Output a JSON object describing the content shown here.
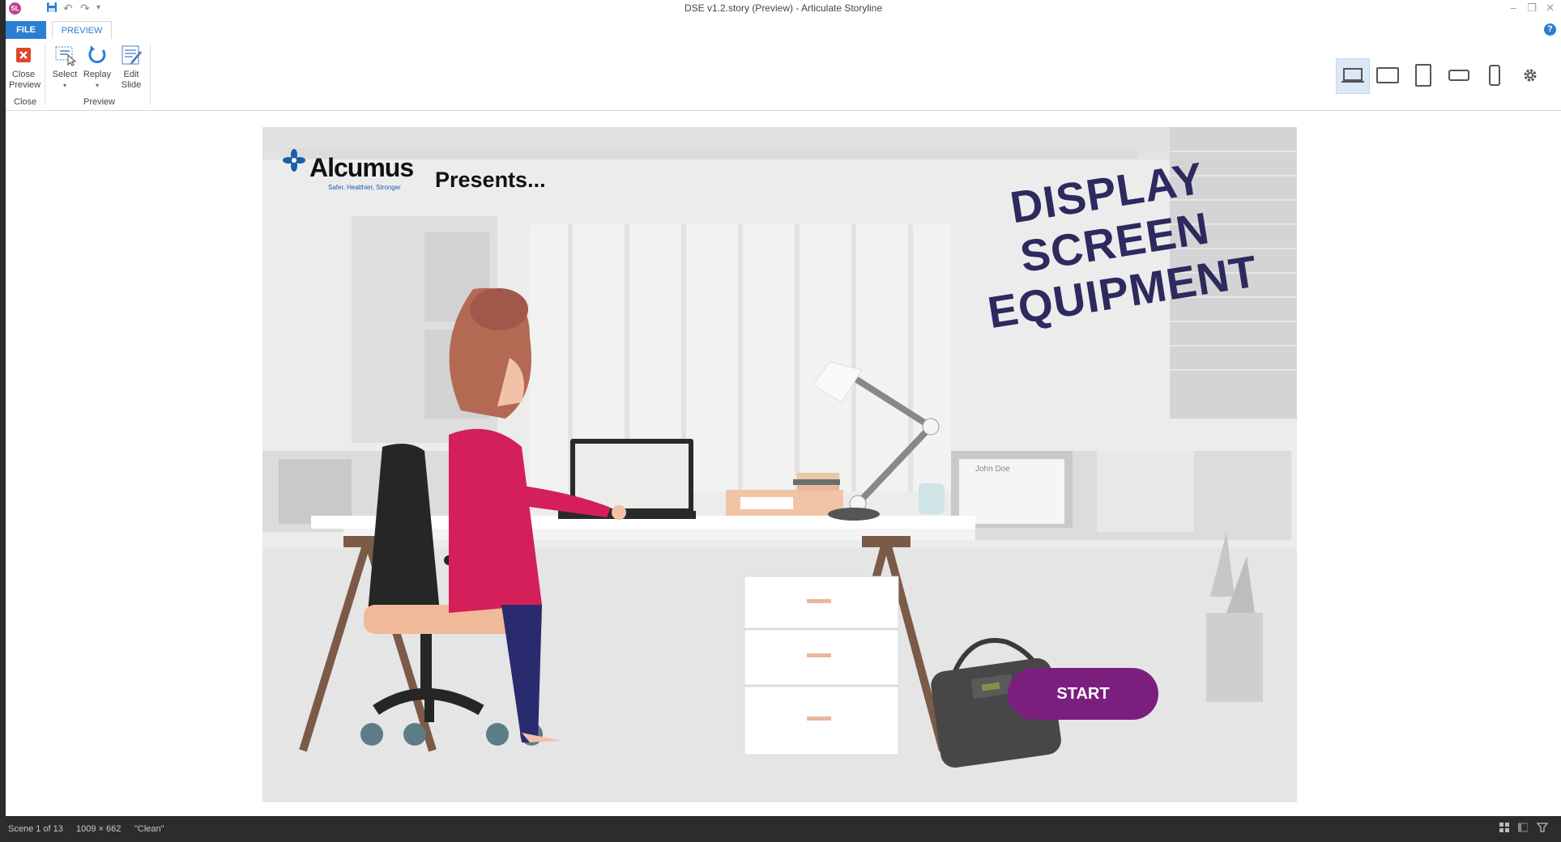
{
  "window": {
    "title": "DSE v1.2.story (Preview) -  Articulate Storyline",
    "app_icon": "SL"
  },
  "tabs": {
    "file": "FILE",
    "preview": "PREVIEW"
  },
  "ribbon": {
    "close_preview": "Close Preview",
    "close_group": "Close",
    "select": "Select",
    "replay": "Replay",
    "edit_slide": "Edit Slide",
    "preview_group": "Preview"
  },
  "slide": {
    "brand": "Alcumus",
    "tagline": "Safer, Healthier, Stronger",
    "presents": "Presents...",
    "heading_lines": [
      "DISPLAY",
      "SCREEN",
      "EQUIPMENT"
    ],
    "start_label": "START",
    "whiteboard_name": "John Doe"
  },
  "status": {
    "scene": "Scene 1 of 13",
    "dimensions": "1009 × 662",
    "state": "\"Clean\""
  },
  "colors": {
    "accent": "#2a7fd4",
    "start_button": "#7b1f7f",
    "heading": "#2c2a5e",
    "shirt": "#d41f5a",
    "close_icon": "#e0462a"
  }
}
